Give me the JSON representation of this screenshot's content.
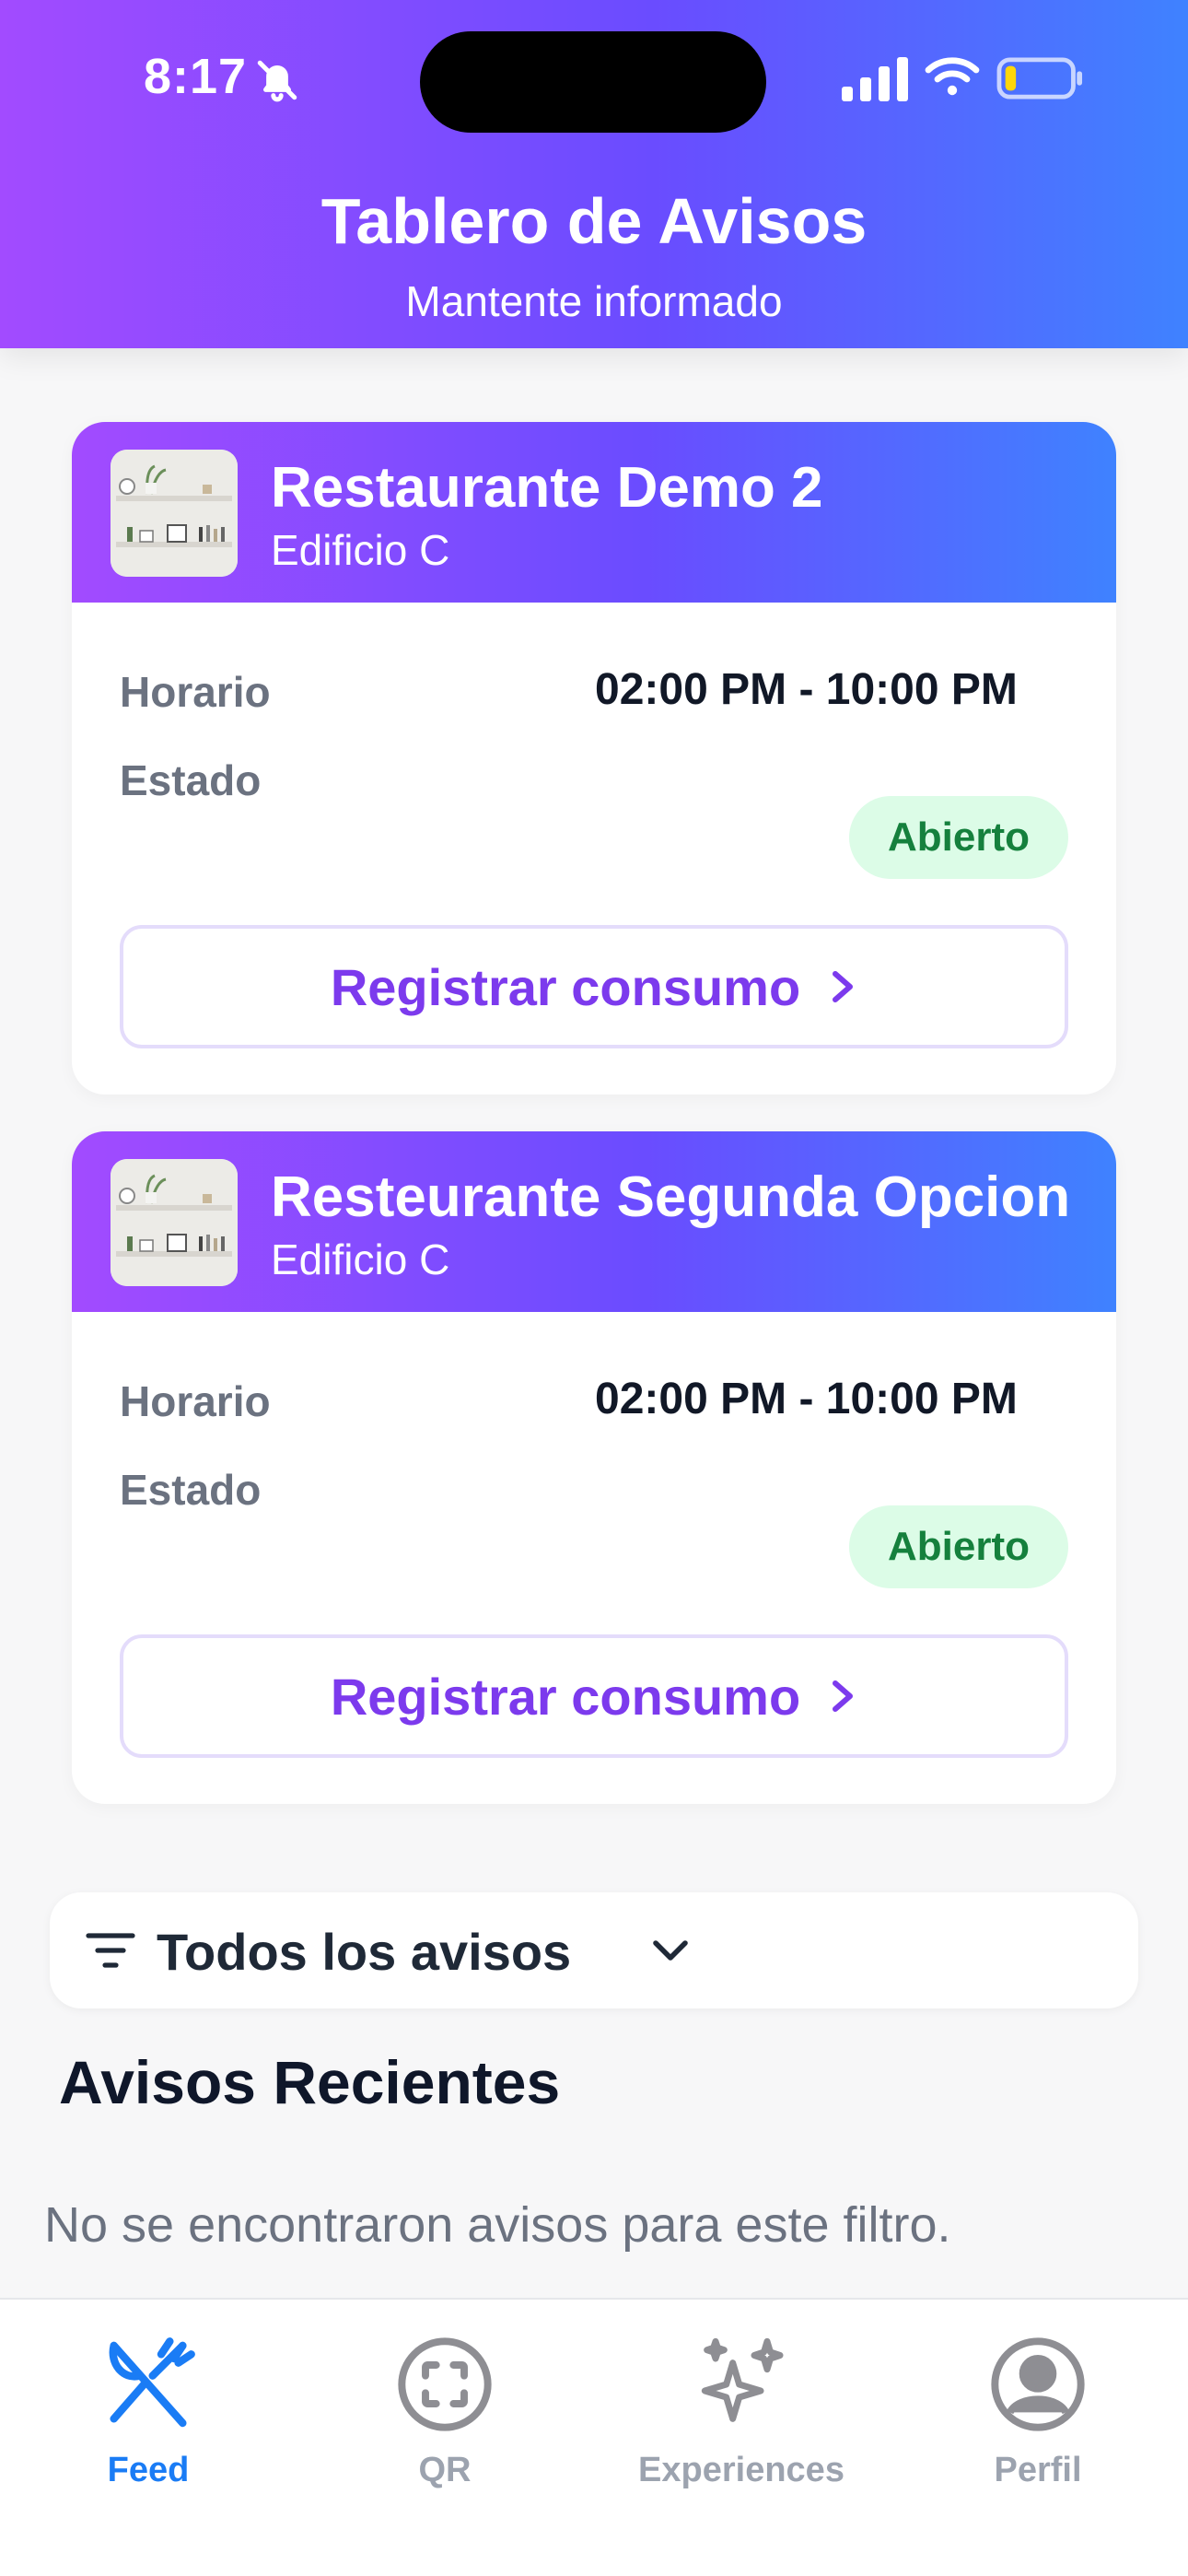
{
  "status_bar": {
    "time": "8:17"
  },
  "header": {
    "title": "Tablero de Avisos",
    "subtitle": "Mantente informado"
  },
  "cards": [
    {
      "name": "Restaurante Demo 2",
      "location": "Edificio C",
      "hours_label": "Horario",
      "status_label": "Estado",
      "hours": "02:00 PM - 10:00 PM",
      "status": "Abierto",
      "button": "Registrar consumo"
    },
    {
      "name": "Resteurante Segunda Opcion",
      "location": "Edificio C",
      "hours_label": "Horario",
      "status_label": "Estado",
      "hours": "02:00 PM - 10:00 PM",
      "status": "Abierto",
      "button": "Registrar consumo"
    }
  ],
  "filter": {
    "label": "Todos los avisos"
  },
  "section": {
    "title": "Avisos Recientes",
    "empty": "No se encontraron avisos para este filtro."
  },
  "tabs": [
    {
      "label": "Feed",
      "icon": "utensils-icon",
      "active": true
    },
    {
      "label": "QR",
      "icon": "qr-scan-icon",
      "active": false
    },
    {
      "label": "Experiences",
      "icon": "sparkles-icon",
      "active": false
    },
    {
      "label": "Perfil",
      "icon": "profile-icon",
      "active": false
    }
  ],
  "colors": {
    "gradient_start": "#a24bff",
    "gradient_end": "#3f82ff",
    "accent_purple": "#7c3aed",
    "status_green": "#15803d",
    "tab_active": "#1a7cf5"
  }
}
